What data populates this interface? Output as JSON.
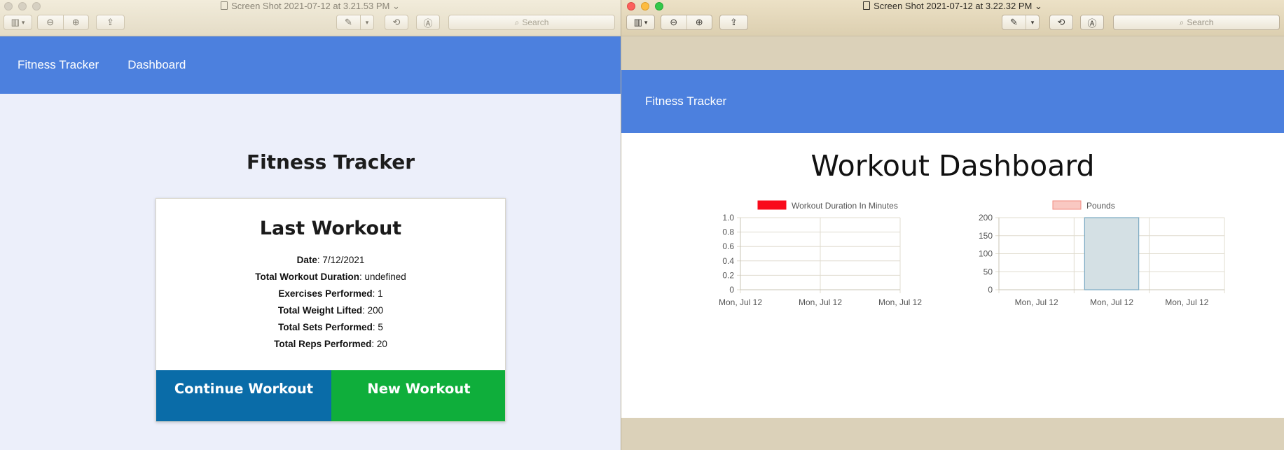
{
  "left_window": {
    "title": "Screen Shot 2021-07-12 at 3.21.53 PM",
    "search_placeholder": "Search",
    "nav": {
      "brand": "Fitness Tracker",
      "links": [
        "Dashboard"
      ]
    },
    "heading": "Fitness Tracker",
    "card": {
      "title": "Last Workout",
      "stats": [
        {
          "label": "Date",
          "value": "7/12/2021"
        },
        {
          "label": "Total Workout Duration",
          "value": "undefined"
        },
        {
          "label": "Exercises Performed",
          "value": "1"
        },
        {
          "label": "Total Weight Lifted",
          "value": "200"
        },
        {
          "label": "Total Sets Performed",
          "value": "5"
        },
        {
          "label": "Total Reps Performed",
          "value": "20"
        }
      ],
      "continue_label": "Continue Workout",
      "new_label": "New Workout"
    }
  },
  "right_window": {
    "title": "Screen Shot 2021-07-12 at 3.22.32 PM",
    "search_placeholder": "Search",
    "nav": {
      "brand": "Fitness Tracker"
    },
    "heading": "Workout Dashboard"
  },
  "colors": {
    "nav": "#4c80de",
    "continue_button": "#0a6ca8",
    "new_button": "#0fae3b",
    "duration_series": "#f90a1b",
    "pounds_series_fill": "#f9c8c2",
    "pounds_series_border": "#f28b82"
  },
  "chart_data": [
    {
      "type": "line",
      "categories": [
        "Mon, Jul 12",
        "Mon, Jul 12",
        "Mon, Jul 12"
      ],
      "series": [
        {
          "name": "Workout Duration In Minutes",
          "values": []
        }
      ],
      "yticks": [
        "0",
        "0.2",
        "0.4",
        "0.6",
        "0.8",
        "1.0"
      ],
      "ylim": [
        0,
        1
      ],
      "grid": true,
      "legend": "top"
    },
    {
      "type": "bar",
      "categories": [
        "Mon, Jul 12",
        "Mon, Jul 12",
        "Mon, Jul 12"
      ],
      "series": [
        {
          "name": "Pounds",
          "values": [
            0,
            200,
            0
          ]
        }
      ],
      "yticks": [
        "0",
        "50",
        "100",
        "150",
        "200"
      ],
      "ylim": [
        0,
        200
      ],
      "grid": true,
      "legend": "top"
    }
  ]
}
